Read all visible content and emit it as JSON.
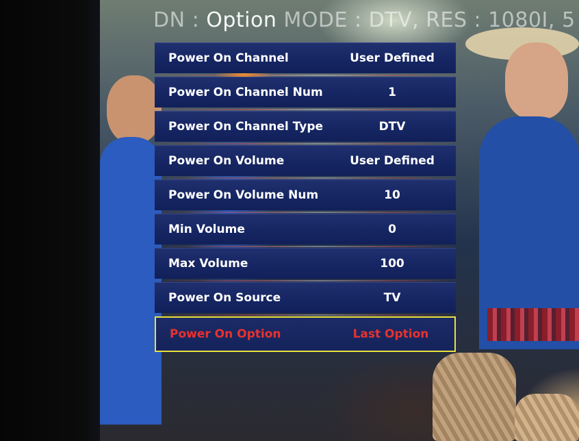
{
  "header": {
    "text_prefix": "D​N : ",
    "text_option": "Option",
    "text_suffix": " MODE : DTV, RES : 1080I, 5"
  },
  "menu": {
    "items": [
      {
        "label": "Power On Channel",
        "value": "User Defined"
      },
      {
        "label": "Power On Channel Num",
        "value": "1"
      },
      {
        "label": "Power On Channel Type",
        "value": "DTV"
      },
      {
        "label": "Power On Volume",
        "value": "User Defined"
      },
      {
        "label": "Power On Volume Num",
        "value": "10"
      },
      {
        "label": "Min Volume",
        "value": "0"
      },
      {
        "label": "Max Volume",
        "value": "100"
      },
      {
        "label": "Power On Source",
        "value": "TV"
      },
      {
        "label": "Power On Option",
        "value": "Last Option",
        "selected": true
      }
    ]
  },
  "colors": {
    "row_background": "#152562",
    "text_normal": "#ffffff",
    "text_selected": "#e8322e",
    "selection_border": "#e9e23a"
  }
}
